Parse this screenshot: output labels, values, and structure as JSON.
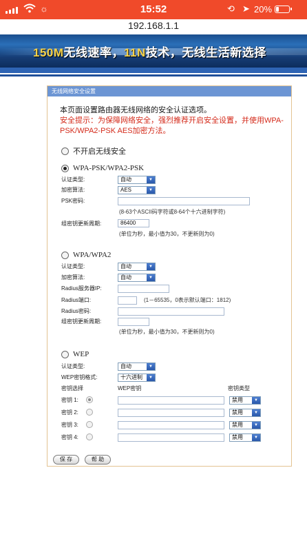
{
  "status_bar": {
    "time": "15:52",
    "battery": "20%",
    "icons": [
      "signal-icon",
      "wifi-icon",
      "brightness-icon",
      "rotation-lock-icon",
      "location-icon",
      "battery-icon"
    ]
  },
  "url": "192.168.1.1",
  "banner": {
    "part1": "150M",
    "part2": "无线速率，",
    "part3": "11N",
    "part4": "技术，无线生活新选择"
  },
  "panel": {
    "title": "无线网络安全设置",
    "intro": "本页面设置路由器无线网络的安全认证选项。",
    "tip": "安全提示：为保障网络安全，强烈推荐开启安全设置，并使用WPA-PSK/WPA2-PSK AES加密方法。"
  },
  "options": {
    "none_label": "不开启无线安全",
    "selected": "WPA-PSK/WPA2-PSK"
  },
  "wpa_psk": {
    "title": "WPA-PSK/WPA2-PSK",
    "auth_label": "认证类型:",
    "auth_value": "自动",
    "enc_label": "加密算法:",
    "enc_value": "AES",
    "psk_label": "PSK密码:",
    "psk_value": "",
    "psk_hint": "(8-63个ASCII码字符或8-64个十六进制字符)",
    "renew_label": "组密钥更新周期:",
    "renew_value": "86400",
    "renew_hint": "(单位为秒，最小值为30，不更新则为0)"
  },
  "wpa": {
    "title": "WPA/WPA2",
    "auth_label": "认证类型:",
    "auth_value": "自动",
    "enc_label": "加密算法:",
    "enc_value": "自动",
    "radius_ip_label": "Radius服务器IP:",
    "radius_port_label": "Radius端口:",
    "radius_port_hint": "(1－65535，0表示默认端口：1812)",
    "radius_pwd_label": "Radius密码:",
    "renew_label": "组密钥更新周期:",
    "renew_hint": "(单位为秒，最小值为30，不更新则为0)"
  },
  "wep": {
    "title": "WEP",
    "auth_label": "认证类型:",
    "auth_value": "自动",
    "format_label": "WEP密钥格式:",
    "format_value": "十六进制",
    "col_select": "密钥选择",
    "col_key": "WEP密钥",
    "col_type": "密钥类型",
    "keys": [
      {
        "label": "密钥 1:",
        "value": "",
        "type": "禁用"
      },
      {
        "label": "密钥 2:",
        "value": "",
        "type": "禁用"
      },
      {
        "label": "密钥 3:",
        "value": "",
        "type": "禁用"
      },
      {
        "label": "密钥 4:",
        "value": "",
        "type": "禁用"
      }
    ]
  },
  "buttons": {
    "save": "保 存",
    "help": "帮 助"
  }
}
